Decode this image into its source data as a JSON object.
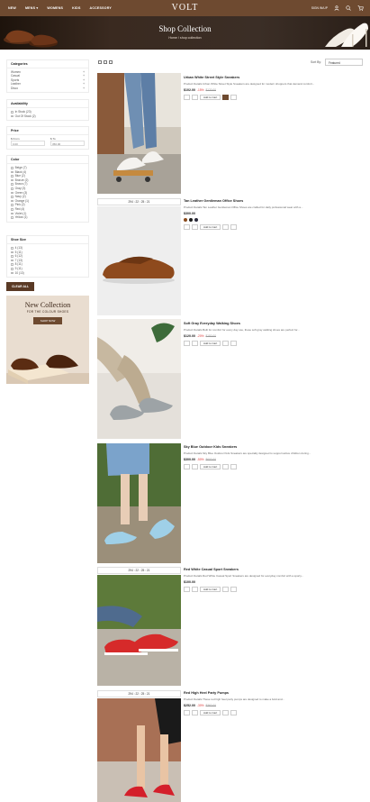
{
  "header": {
    "nav": [
      "NEW",
      "MENS ▾",
      "WOMENS",
      "KIDS",
      "ACCESSORY"
    ],
    "logo": "VOLT",
    "account": "SIGN IN/UP",
    "icons": [
      "user-icon",
      "search-icon",
      "cart-icon"
    ]
  },
  "hero": {
    "title": "Shop Collection",
    "breadcrumb": "Home / shop collection"
  },
  "filters": {
    "categories": {
      "title": "Categories",
      "items": [
        "Women",
        "Casual",
        "Sports",
        "Leather",
        "Disco"
      ]
    },
    "availability": {
      "title": "Availability",
      "items": [
        "In Stock (23)",
        "Out Of Stock (2)"
      ]
    },
    "price": {
      "title": "Price",
      "from_label": "$ From",
      "to_label": "$ To",
      "from_value": "0.00",
      "to_value": "350.00"
    },
    "color": {
      "title": "Color",
      "items": [
        "Beige (7)",
        "Black (4)",
        "Blue (2)",
        "Bronze (2)",
        "Brown (7)",
        "Gray (3)",
        "Green (3)",
        "Navy (2)",
        "Orange (1)",
        "Pink (2)",
        "Red (4)",
        "Violet (1)",
        "Yellow (1)"
      ]
    },
    "shoe_size": {
      "title": "Shoe Size",
      "items": [
        "4 (13)",
        "5 (11)",
        "6 (12)",
        "7 (13)",
        "8 (11)",
        "9 (11)",
        "10 (13)"
      ]
    },
    "clear_all": "CLEAR ALL"
  },
  "promo": {
    "title": "New Collection",
    "subtitle": "FOR THE COLOUR SHOES",
    "button": "SHOP NOW"
  },
  "toolbar": {
    "sort_label": "Sort By:",
    "sort_value": "Featured"
  },
  "products": [
    {
      "name": "Urban White Street Style Sneakers",
      "desc": "Product Details Urban White Street Style Sneakers are designed for modern shoppers that demand comfort...",
      "price": "$102.00",
      "discount": "-15%",
      "old_price": "$120.00",
      "add": "Add to Cart",
      "timer": ""
    },
    {
      "name": "Tan Leather Gentleman Office Shoes",
      "desc": "Product Details Tan Leather Gentleman Office Shoes are crafted for daily professional wear with a...",
      "price": "$300.00",
      "discount": "",
      "old_price": "",
      "add": "Add to Cart",
      "timer": "294 : 22 : 25 : 21",
      "swatches": [
        "#8a4a1c",
        "#1c1c1c",
        "#2a2a3a"
      ]
    },
    {
      "name": "Soft Gray Everyday Walking Shoes",
      "desc": "Product Details Built for comfort for every day use, these soft gray walking shoes are perfect for...",
      "price": "$120.00",
      "discount": "-20%",
      "old_price": "$150.00",
      "add": "Add to Cart",
      "timer": ""
    },
    {
      "name": "Sky Blue Outdoor Kids Sneakers",
      "desc": "Product Details Sky Blue Outdoor Kids Sneakers are specially designed to support active children during...",
      "price": "$300.00",
      "discount": "-50%",
      "old_price": "$600.00",
      "add": "Add to Cart",
      "timer": ""
    },
    {
      "name": "Red White Casual Sport Sneakers",
      "desc": "Product Details Red White Casual Sport Sneakers are designed for everyday comfort with a sporty...",
      "price": "$100.00",
      "discount": "",
      "old_price": "",
      "add": "Add to Cart",
      "timer": "294 : 22 : 25 : 21"
    },
    {
      "name": "Red High Heel Party Pumps",
      "desc": "Product Details These red high heel party pumps are designed to make a bold and...",
      "price": "$252.00",
      "discount": "-30%",
      "old_price": "$360.00",
      "add": "Add to Cart",
      "timer": "294 : 22 : 25 : 21"
    }
  ],
  "colors": {
    "header_bg": "#6e4a30",
    "accent": "#5a3a25",
    "sale": "#dd3333"
  }
}
